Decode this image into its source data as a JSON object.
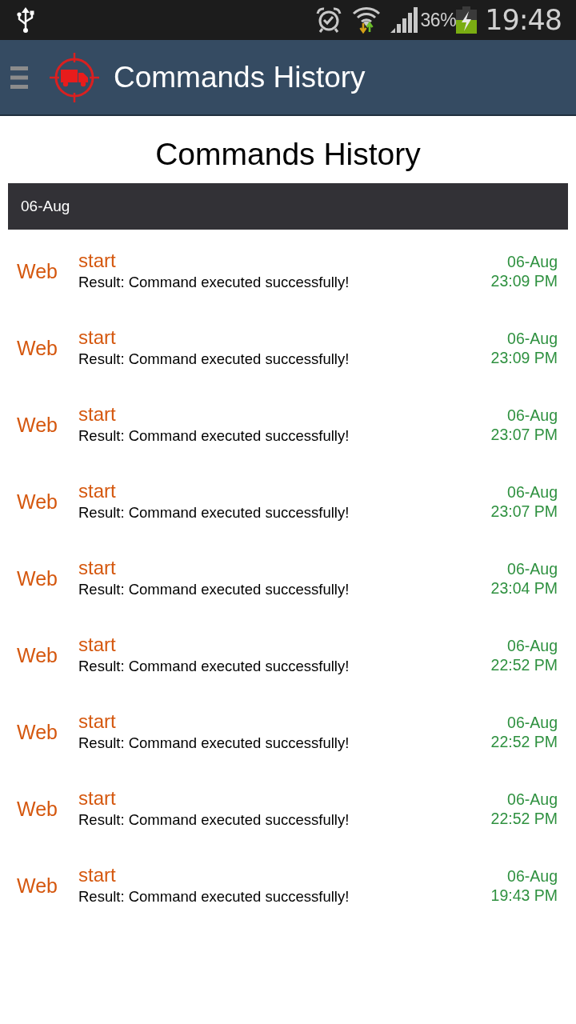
{
  "status_bar": {
    "battery": "36%",
    "time": "19:48"
  },
  "app_bar": {
    "title": "Commands History"
  },
  "page_title": "Commands History",
  "groups": [
    {
      "date": "06-Aug",
      "commands": [
        {
          "source": "Web",
          "command": "start",
          "result": "Result: Command executed successfully!",
          "date": "06-Aug",
          "time": "23:09 PM"
        },
        {
          "source": "Web",
          "command": "start",
          "result": "Result: Command executed successfully!",
          "date": "06-Aug",
          "time": "23:09 PM"
        },
        {
          "source": "Web",
          "command": "start",
          "result": "Result: Command executed successfully!",
          "date": "06-Aug",
          "time": "23:07 PM"
        },
        {
          "source": "Web",
          "command": "start",
          "result": "Result: Command executed successfully!",
          "date": "06-Aug",
          "time": "23:07 PM"
        },
        {
          "source": "Web",
          "command": "start",
          "result": "Result: Command executed successfully!",
          "date": "06-Aug",
          "time": "23:04 PM"
        },
        {
          "source": "Web",
          "command": "start",
          "result": "Result: Command executed successfully!",
          "date": "06-Aug",
          "time": "22:52 PM"
        },
        {
          "source": "Web",
          "command": "start",
          "result": "Result: Command executed successfully!",
          "date": "06-Aug",
          "time": "22:52 PM"
        },
        {
          "source": "Web",
          "command": "start",
          "result": "Result: Command executed successfully!",
          "date": "06-Aug",
          "time": "22:52 PM"
        },
        {
          "source": "Web",
          "command": "start",
          "result": "Result: Command executed successfully!",
          "date": "06-Aug",
          "time": "19:43 PM"
        }
      ]
    }
  ]
}
